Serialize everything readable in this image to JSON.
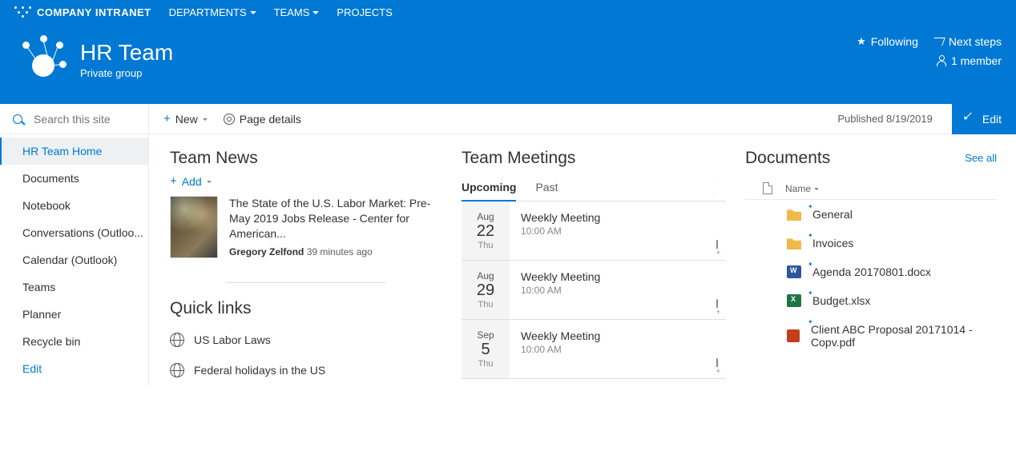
{
  "topnav": {
    "company": "COMPANY INTRANET",
    "links": [
      "DEPARTMENTS",
      "TEAMS",
      "PROJECTS"
    ]
  },
  "hero": {
    "title": "HR Team",
    "subtitle": "Private group",
    "following": "Following",
    "next_steps": "Next steps",
    "members": "1 member"
  },
  "cmdbar": {
    "search_placeholder": "Search this site",
    "new_label": "New",
    "page_details": "Page details",
    "published": "Published 8/19/2019",
    "edit": "Edit"
  },
  "sidebar": {
    "items": [
      "HR Team Home",
      "Documents",
      "Notebook",
      "Conversations (Outloo...",
      "Calendar (Outlook)",
      "Teams",
      "Planner",
      "Recycle bin"
    ],
    "edit": "Edit"
  },
  "news": {
    "heading": "Team News",
    "add": "Add",
    "item": {
      "title": "The State of the U.S. Labor Market: Pre-May 2019 Jobs Release - Center for American...",
      "author": "Gregory Zelfond",
      "time": "39 minutes ago"
    }
  },
  "quicklinks": {
    "heading": "Quick links",
    "items": [
      "US Labor Laws",
      "Federal holidays in the US"
    ]
  },
  "meetings": {
    "heading": "Team Meetings",
    "tabs": {
      "upcoming": "Upcoming",
      "past": "Past"
    },
    "items": [
      {
        "mon": "Aug",
        "day": "22",
        "dow": "Thu",
        "title": "Weekly Meeting",
        "time": "10:00 AM"
      },
      {
        "mon": "Aug",
        "day": "29",
        "dow": "Thu",
        "title": "Weekly Meeting",
        "time": "10:00 AM"
      },
      {
        "mon": "Sep",
        "day": "5",
        "dow": "Thu",
        "title": "Weekly Meeting",
        "time": "10:00 AM"
      }
    ]
  },
  "documents": {
    "heading": "Documents",
    "see_all": "See all",
    "name_col": "Name",
    "items": [
      {
        "type": "folder",
        "name": "General"
      },
      {
        "type": "folder",
        "name": "Invoices"
      },
      {
        "type": "docx",
        "name": "Agenda 20170801.docx"
      },
      {
        "type": "xlsx",
        "name": "Budget.xlsx"
      },
      {
        "type": "pdf",
        "name": "Client ABC Proposal 20171014 - Copv.pdf"
      }
    ]
  }
}
